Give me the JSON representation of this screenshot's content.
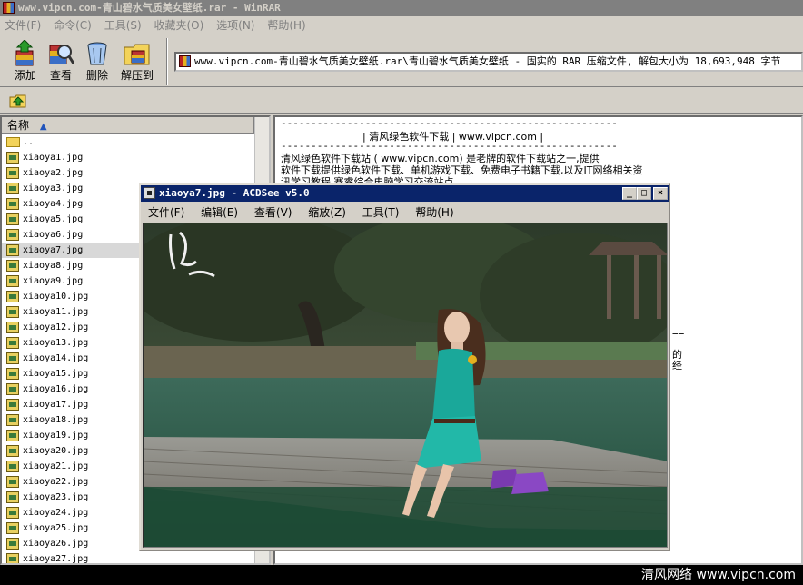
{
  "winrar": {
    "title": "www.vipcn.com-青山碧水气质美女壁纸.rar - WinRAR",
    "menu": [
      "文件(F)",
      "命令(C)",
      "工具(S)",
      "收藏夹(O)",
      "选项(N)",
      "帮助(H)"
    ],
    "toolbar": {
      "add": "添加",
      "view": "查看",
      "delete": "删除",
      "extract": "解压到"
    },
    "address": "www.vipcn.com-青山碧水气质美女壁纸.rar\\青山碧水气质美女壁纸 - 固实的 RAR 压缩文件, 解包大小为 18,693,948 字节",
    "column_name": "名称",
    "files": [
      "..",
      "xiaoya1.jpg",
      "xiaoya2.jpg",
      "xiaoya3.jpg",
      "xiaoya4.jpg",
      "xiaoya5.jpg",
      "xiaoya6.jpg",
      "xiaoya7.jpg",
      "xiaoya8.jpg",
      "xiaoya9.jpg",
      "xiaoya10.jpg",
      "xiaoya11.jpg",
      "xiaoya12.jpg",
      "xiaoya13.jpg",
      "xiaoya14.jpg",
      "xiaoya15.jpg",
      "xiaoya16.jpg",
      "xiaoya17.jpg",
      "xiaoya18.jpg",
      "xiaoya19.jpg",
      "xiaoya20.jpg",
      "xiaoya21.jpg",
      "xiaoya22.jpg",
      "xiaoya23.jpg",
      "xiaoya24.jpg",
      "xiaoya25.jpg",
      "xiaoya26.jpg",
      "xiaoya27.jpg"
    ],
    "selected_file": "xiaoya7.jpg",
    "comment": {
      "rule": "--------------------------------------------------------",
      "header": "| 清风绿色软件下载 | www.vipcn.com |",
      "line1": "      清风绿色软件下载站 ( www.vipcn.com) 是老牌的软件下载站之一,提供",
      "line2": "软件下载提供绿色软件下载、单机游戏下载、免费电子书籍下载,以及IT网络相关资",
      "line3": "讯学习教程,赛睿综合电脑学习交流站点。",
      "frag1": "==",
      "frag2": "的",
      "frag3": "经"
    }
  },
  "acdsee": {
    "title": "xiaoya7.jpg - ACDSee v5.0",
    "menu": [
      "文件(F)",
      "编辑(E)",
      "查看(V)",
      "缩放(Z)",
      "工具(T)",
      "帮助(H)"
    ],
    "buttons": {
      "minimize": "_",
      "maximize": "□",
      "close": "×"
    }
  },
  "watermark": "清风网络 www.vipcn.com",
  "colors": {
    "title_active": "#0a246a",
    "title_inactive": "#808080",
    "window_face": "#d4d0c8"
  }
}
